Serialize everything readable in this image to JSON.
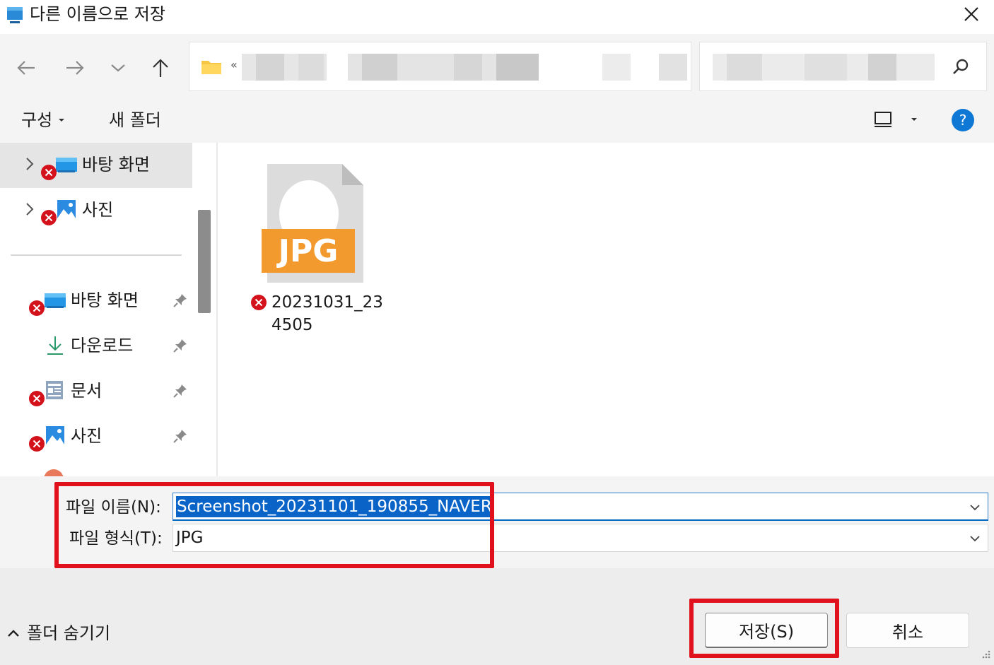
{
  "window": {
    "title": "다른 이름으로 저장",
    "close_icon": "close-icon"
  },
  "nav": {
    "back_icon": "arrow-left-icon",
    "forward_icon": "arrow-right-icon",
    "recent_icon": "chevron-down-icon",
    "up_icon": "arrow-up-icon",
    "address_prefix": "«",
    "search_icon": "search-icon"
  },
  "commandbar": {
    "organize_label": "구성",
    "new_folder_label": "새 폴더",
    "view_icon": "view-icon",
    "help_icon": "help-icon",
    "help_glyph": "?"
  },
  "tree": {
    "top_items": [
      {
        "label": "바탕 화면",
        "icon": "desktop-icon",
        "selected": true
      },
      {
        "label": "사진",
        "icon": "pictures-icon",
        "selected": false
      }
    ],
    "quick_access": [
      {
        "label": "바탕 화면",
        "icon": "desktop-icon",
        "pinned": true
      },
      {
        "label": "다운로드",
        "icon": "download-icon",
        "pinned": true
      },
      {
        "label": "문서",
        "icon": "documents-icon",
        "pinned": true
      },
      {
        "label": "사진",
        "icon": "pictures-icon",
        "pinned": true
      }
    ]
  },
  "files": [
    {
      "type_badge": "JPG",
      "name": "20231031_234505",
      "icon": "jpg-file-icon"
    }
  ],
  "form": {
    "filename_label": "파일 이름(N):",
    "filename_value": "Screenshot_20231101_190855_NAVER",
    "filetype_label": "파일 형식(T):",
    "filetype_value": "JPG"
  },
  "buttons": {
    "hide_folders_label": "폴더 숨기기",
    "save_label": "저장(S)",
    "cancel_label": "취소"
  },
  "colors": {
    "highlight": "#e0101c",
    "selection": "#0a64c8",
    "accent": "#0067c0",
    "jpg_badge": "#f29a2e",
    "error_badge": "#d3121c"
  }
}
